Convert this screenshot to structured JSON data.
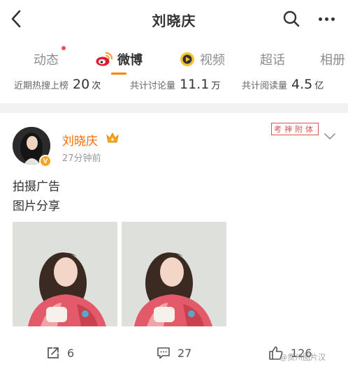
{
  "header": {
    "title": "刘晓庆"
  },
  "tabs": [
    {
      "label": "动态",
      "has_dot": true
    },
    {
      "label": "微博",
      "active": true,
      "icon": "weibo-icon"
    },
    {
      "label": "视频",
      "icon": "video-icon"
    },
    {
      "label": "超话"
    },
    {
      "label": "相册"
    }
  ],
  "stats": [
    {
      "label": "近期热搜上榜",
      "value": "20",
      "unit": "次"
    },
    {
      "label": "共计讨论量",
      "value": "11.1",
      "unit": "万"
    },
    {
      "label": "共计阅读量",
      "value": "4.5",
      "unit": "亿"
    }
  ],
  "post": {
    "author": "刘晓庆",
    "time": "27分钟前",
    "stamp": "考神附体",
    "lines": [
      "拍摄广告",
      "图片分享"
    ],
    "actions": {
      "reposts": "6",
      "comments": "27",
      "likes": "126"
    },
    "watermark": "@贵州图片汉"
  },
  "colors": {
    "accent": "#ff8200",
    "author": "#ff6a00",
    "dot": "#f24e4e",
    "stamp": "#d9534f"
  }
}
